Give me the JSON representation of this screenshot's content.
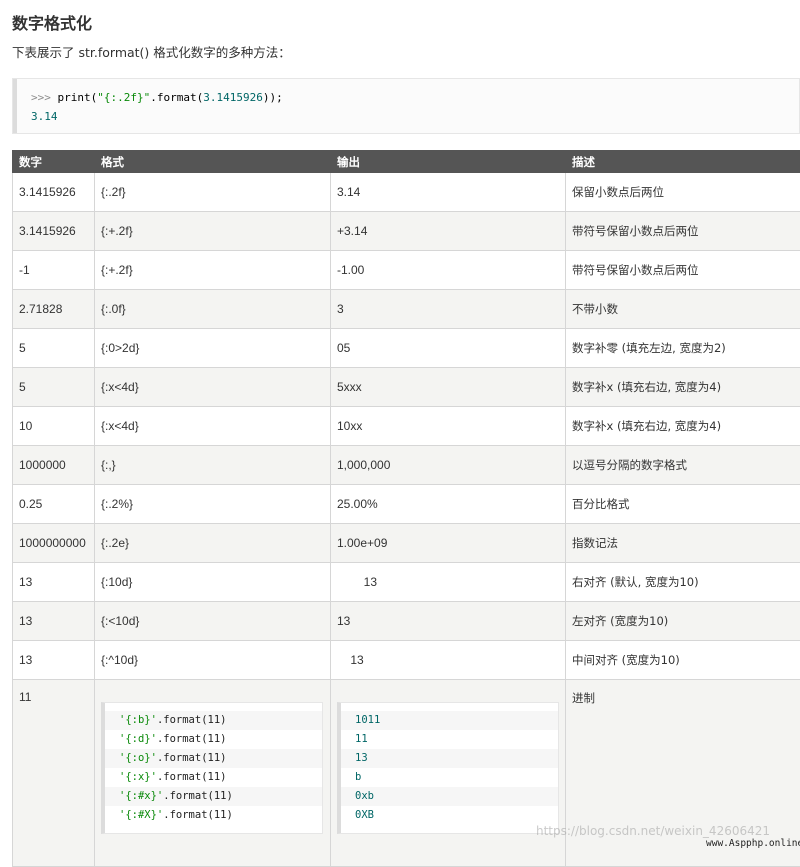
{
  "heading": "数字格式化",
  "intro": "下表展示了 str.format() 格式化数字的多种方法：",
  "example": {
    "prompt": ">>> ",
    "func": "print(",
    "str": "\"{:.2f}\"",
    "mid": ".format(",
    "num": "3.1415926",
    "end": "));",
    "output": "3.14"
  },
  "table": {
    "headers": [
      "数字",
      "格式",
      "输出",
      "描述"
    ],
    "rows": [
      [
        "3.1415926",
        "{:.2f}",
        "3.14",
        "保留小数点后两位"
      ],
      [
        "3.1415926",
        "{:+.2f}",
        "+3.14",
        "带符号保留小数点后两位"
      ],
      [
        "-1",
        "{:+.2f}",
        "-1.00",
        "带符号保留小数点后两位"
      ],
      [
        "2.71828",
        "{:.0f}",
        "3",
        "不带小数"
      ],
      [
        "5",
        "{:0>2d}",
        "05",
        "数字补零 (填充左边, 宽度为2)"
      ],
      [
        "5",
        "{:x<4d}",
        "5xxx",
        "数字补x (填充右边, 宽度为4)"
      ],
      [
        "10",
        "{:x<4d}",
        "10xx",
        "数字补x (填充右边, 宽度为4)"
      ],
      [
        "1000000",
        "{:,}",
        "1,000,000",
        "以逗号分隔的数字格式"
      ],
      [
        "0.25",
        "{:.2%}",
        "25.00%",
        "百分比格式"
      ],
      [
        "1000000000",
        "{:.2e}",
        "1.00e+09",
        "指数记法"
      ],
      [
        "13",
        "{:10d}",
        "        13",
        "右对齐 (默认, 宽度为10)"
      ],
      [
        "13",
        "{:<10d}",
        "13",
        "左对齐 (宽度为10)"
      ],
      [
        "13",
        "{:^10d}",
        "    13",
        "中间对齐 (宽度为10)"
      ]
    ],
    "last_row": {
      "number": "11",
      "description": "进制",
      "code_lines": [
        {
          "str": "'{:b}'",
          "rest": ".format(11)"
        },
        {
          "str": "'{:d}'",
          "rest": ".format(11)"
        },
        {
          "str": "'{:o}'",
          "rest": ".format(11)"
        },
        {
          "str": "'{:x}'",
          "rest": ".format(11)"
        },
        {
          "str": "'{:#x}'",
          "rest": ".format(11)"
        },
        {
          "str": "'{:#X}'",
          "rest": ".format(11)"
        }
      ],
      "outputs": [
        "1011",
        "11",
        "13",
        "b",
        "0xb",
        "0XB"
      ]
    }
  },
  "watermark": "https://blog.csdn.net/weixin_42606421",
  "site": "www.Aspphp.online"
}
